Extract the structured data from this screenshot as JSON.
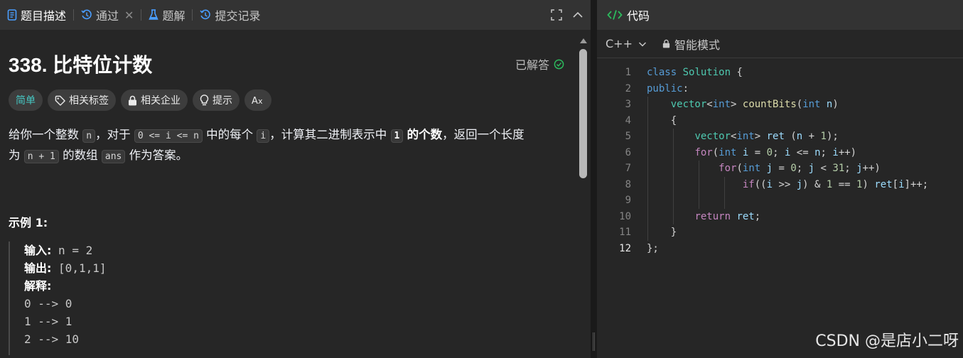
{
  "left_tabs": {
    "description": "题目描述",
    "submissions_status": "通过",
    "solutions": "题解",
    "records": "提交记录"
  },
  "problem": {
    "title": "338. 比特位计数",
    "status": "已解答",
    "tags": {
      "difficulty": "简单",
      "related_tags": "相关标签",
      "companies": "相关企业",
      "hint": "提示",
      "translate": "A̅"
    },
    "desc": {
      "p1": "给你一个整数",
      "c1": "n",
      "p2": "，对于",
      "c2": "0 <= i <= n",
      "p3": "中的每个",
      "c3": "i",
      "p4": "，计算其二进制表示中",
      "c4": "1",
      "p5": "的个数",
      "p6": "，返回一个长度",
      "p7": "为",
      "c5": "n + 1",
      "p8": "的数组",
      "c6": "ans",
      "p9": "作为答案。"
    },
    "example": {
      "title": "示例 1:",
      "input_label": "输入:",
      "input_value": "n = 2",
      "output_label": "输出:",
      "output_value": "[0,1,1]",
      "explain_label": "解释:",
      "lines": [
        "0 --> 0",
        "1 --> 1",
        "2 --> 10"
      ]
    }
  },
  "right": {
    "tab_label": "代码",
    "language": "C++",
    "mode": "智能模式"
  },
  "editor": {
    "current_line": 12,
    "line_numbers": [
      "1",
      "2",
      "3",
      "4",
      "5",
      "6",
      "7",
      "8",
      "9",
      "10",
      "11",
      "12"
    ]
  },
  "watermark": "CSDN @是店小二呀",
  "colors": {
    "accent_easy": "#46c6c2",
    "solved_check": "#2cbb5d",
    "code_tab_icon": "#2cbb5d"
  }
}
